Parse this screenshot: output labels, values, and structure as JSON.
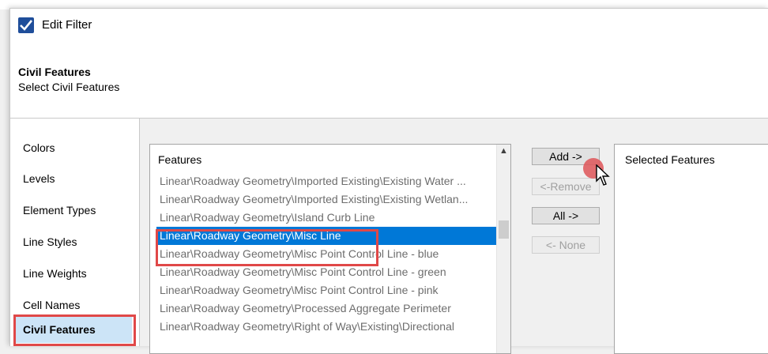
{
  "window": {
    "title": "Edit Filter"
  },
  "header": {
    "title": "Civil Features",
    "subtitle": "Select Civil Features"
  },
  "nav": {
    "items": [
      {
        "label": "Colors"
      },
      {
        "label": "Levels"
      },
      {
        "label": "Element Types"
      },
      {
        "label": "Line Styles"
      },
      {
        "label": "Line Weights"
      },
      {
        "label": "Cell Names"
      },
      {
        "label": "Civil Features",
        "active": true
      }
    ]
  },
  "features_list": {
    "header": "Features",
    "rows": [
      "Linear\\Roadway Geometry\\Imported Existing\\Existing Water ...",
      "Linear\\Roadway Geometry\\Imported Existing\\Existing Wetlan...",
      "Linear\\Roadway Geometry\\Island Curb Line",
      "Linear\\Roadway Geometry\\Misc Line",
      "Linear\\Roadway Geometry\\Misc Point Control Line - blue",
      "Linear\\Roadway Geometry\\Misc Point Control Line - green",
      "Linear\\Roadway Geometry\\Misc Point Control Line - pink",
      "Linear\\Roadway Geometry\\Processed Aggregate Perimeter",
      "Linear\\Roadway Geometry\\Right of Way\\Existing\\Directional"
    ],
    "selected_index": 3
  },
  "buttons": {
    "add": "Add ->",
    "remove": "<-Remove",
    "all": "All ->",
    "none": "<- None"
  },
  "selected_features": {
    "header": "Selected Features"
  },
  "colors": {
    "selection": "#0078d7",
    "highlight_box": "#e04848",
    "cursor_dot": "#de5558"
  }
}
